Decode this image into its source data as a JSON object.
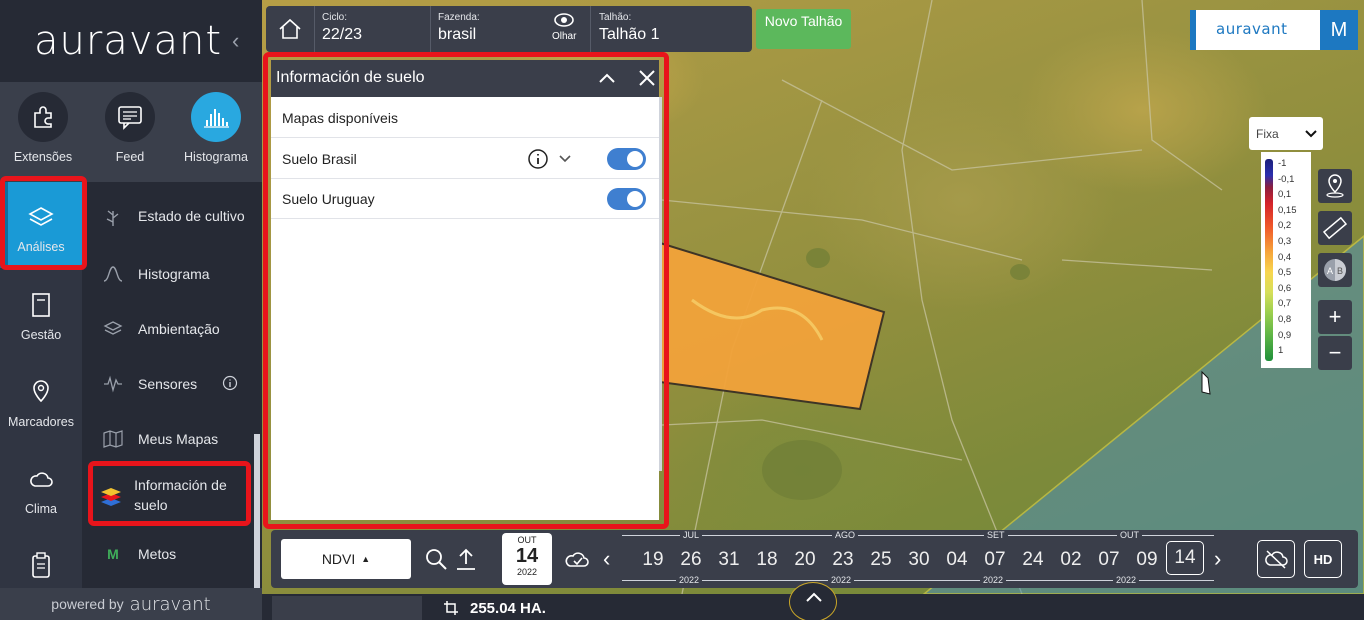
{
  "sidebar": {
    "logo": "auravant",
    "quick": [
      {
        "label": "Extensões",
        "icon": "puzzle-icon"
      },
      {
        "label": "Feed",
        "icon": "chat-icon"
      },
      {
        "label": "Histograma",
        "icon": "histogram-icon"
      }
    ],
    "rail": [
      {
        "label": "Análises",
        "icon": "layers-icon"
      },
      {
        "label": "Gestão",
        "icon": "notebook-icon"
      },
      {
        "label": "Marcadores",
        "icon": "pin-icon"
      },
      {
        "label": "Clima",
        "icon": "cloud-icon"
      }
    ],
    "submenu": [
      {
        "label": "Estado de cultivo",
        "icon": "plant-icon"
      },
      {
        "label": "Histograma",
        "icon": "curve-icon"
      },
      {
        "label": "Ambientação",
        "icon": "layers-icon"
      },
      {
        "label": "Sensores",
        "icon": "signal-icon"
      },
      {
        "label": "Meus Mapas",
        "icon": "map-icon"
      },
      {
        "label": "Información de suelo",
        "icon": "soil-layers-icon"
      },
      {
        "label": "Metos",
        "icon": "metos-icon",
        "icon_text": "M"
      }
    ],
    "powered_by": "powered by",
    "powered_logo": "auravant"
  },
  "topbar": {
    "ciclo_label": "Ciclo:",
    "ciclo_value": "22/23",
    "fazenda_label": "Fazenda:",
    "fazenda_value": "brasil",
    "olhar_label": "Olhar",
    "talhao_label": "Talhão:",
    "talhao_value": "Talhão 1",
    "novo_talhao": "Novo Talhão"
  },
  "brand": {
    "name": "auravant",
    "avatar_letter": "M"
  },
  "panel": {
    "title": "Información de suelo",
    "header_row": "Mapas disponíveis",
    "layers": [
      {
        "label": "Suelo Brasil",
        "enabled": true
      },
      {
        "label": "Suelo Uruguay",
        "enabled": true
      }
    ]
  },
  "legend": {
    "mode": "Fixa",
    "values": [
      "-1",
      "-0,1",
      "0,1",
      "0,15",
      "0,2",
      "0,3",
      "0,4",
      "0,5",
      "0,6",
      "0,7",
      "0,8",
      "0,9",
      "1"
    ]
  },
  "timeline": {
    "index": "NDVI",
    "current": {
      "month": "OUT",
      "day": "14",
      "year": "2022"
    },
    "months": [
      {
        "label": "JUL",
        "year": "2022"
      },
      {
        "label": "AGO",
        "year": "2022"
      },
      {
        "label": "SET",
        "year": "2022"
      },
      {
        "label": "OUT",
        "year": "2022"
      }
    ],
    "dates": [
      "19",
      "26",
      "31",
      "18",
      "20",
      "23",
      "25",
      "30",
      "04",
      "07",
      "24",
      "02",
      "07",
      "09",
      "14"
    ],
    "selected_date": "14",
    "hd_label": "HD"
  },
  "bottombar": {
    "area": "255.04 HA."
  },
  "colors": {
    "accent": "#29a8e0",
    "highlight": "#e8141b",
    "toggle": "#3f7fd0",
    "novo": "#5cb85c"
  }
}
